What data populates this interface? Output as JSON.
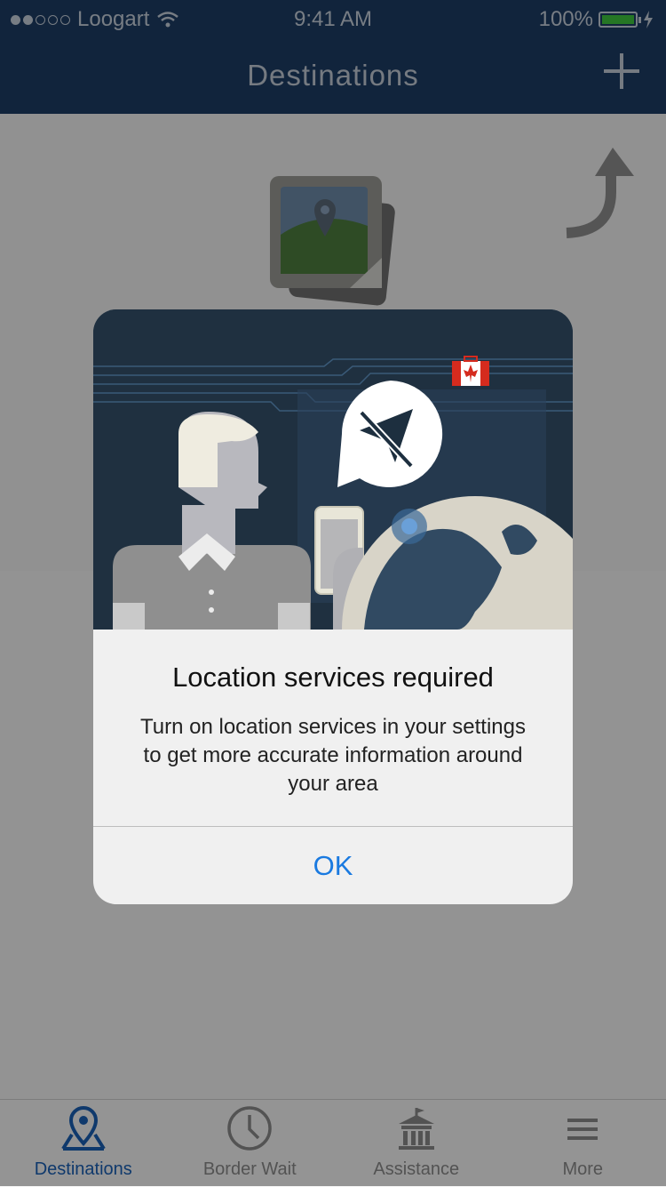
{
  "status_bar": {
    "carrier": "Loogart",
    "time": "9:41 AM",
    "battery": "100%",
    "battery_level": 1.0
  },
  "header": {
    "title": "Destinations",
    "add_icon": "plus-icon"
  },
  "alert": {
    "title": "Location services required",
    "message": "Turn on location services in your settings to get more accurate information around your area",
    "ok_label": "OK"
  },
  "tabs": [
    {
      "label": "Destinations",
      "icon": "map-pin-icon",
      "active": true
    },
    {
      "label": "Border Wait",
      "icon": "clock-icon",
      "active": false
    },
    {
      "label": "Assistance",
      "icon": "bank-icon",
      "active": false
    },
    {
      "label": "More",
      "icon": "menu-icon",
      "active": false
    }
  ],
  "colors": {
    "header_bg": "#1d3c64",
    "accent": "#1a5fb4",
    "ok_text": "#1a7ae0",
    "canada_red": "#d52b1e"
  }
}
